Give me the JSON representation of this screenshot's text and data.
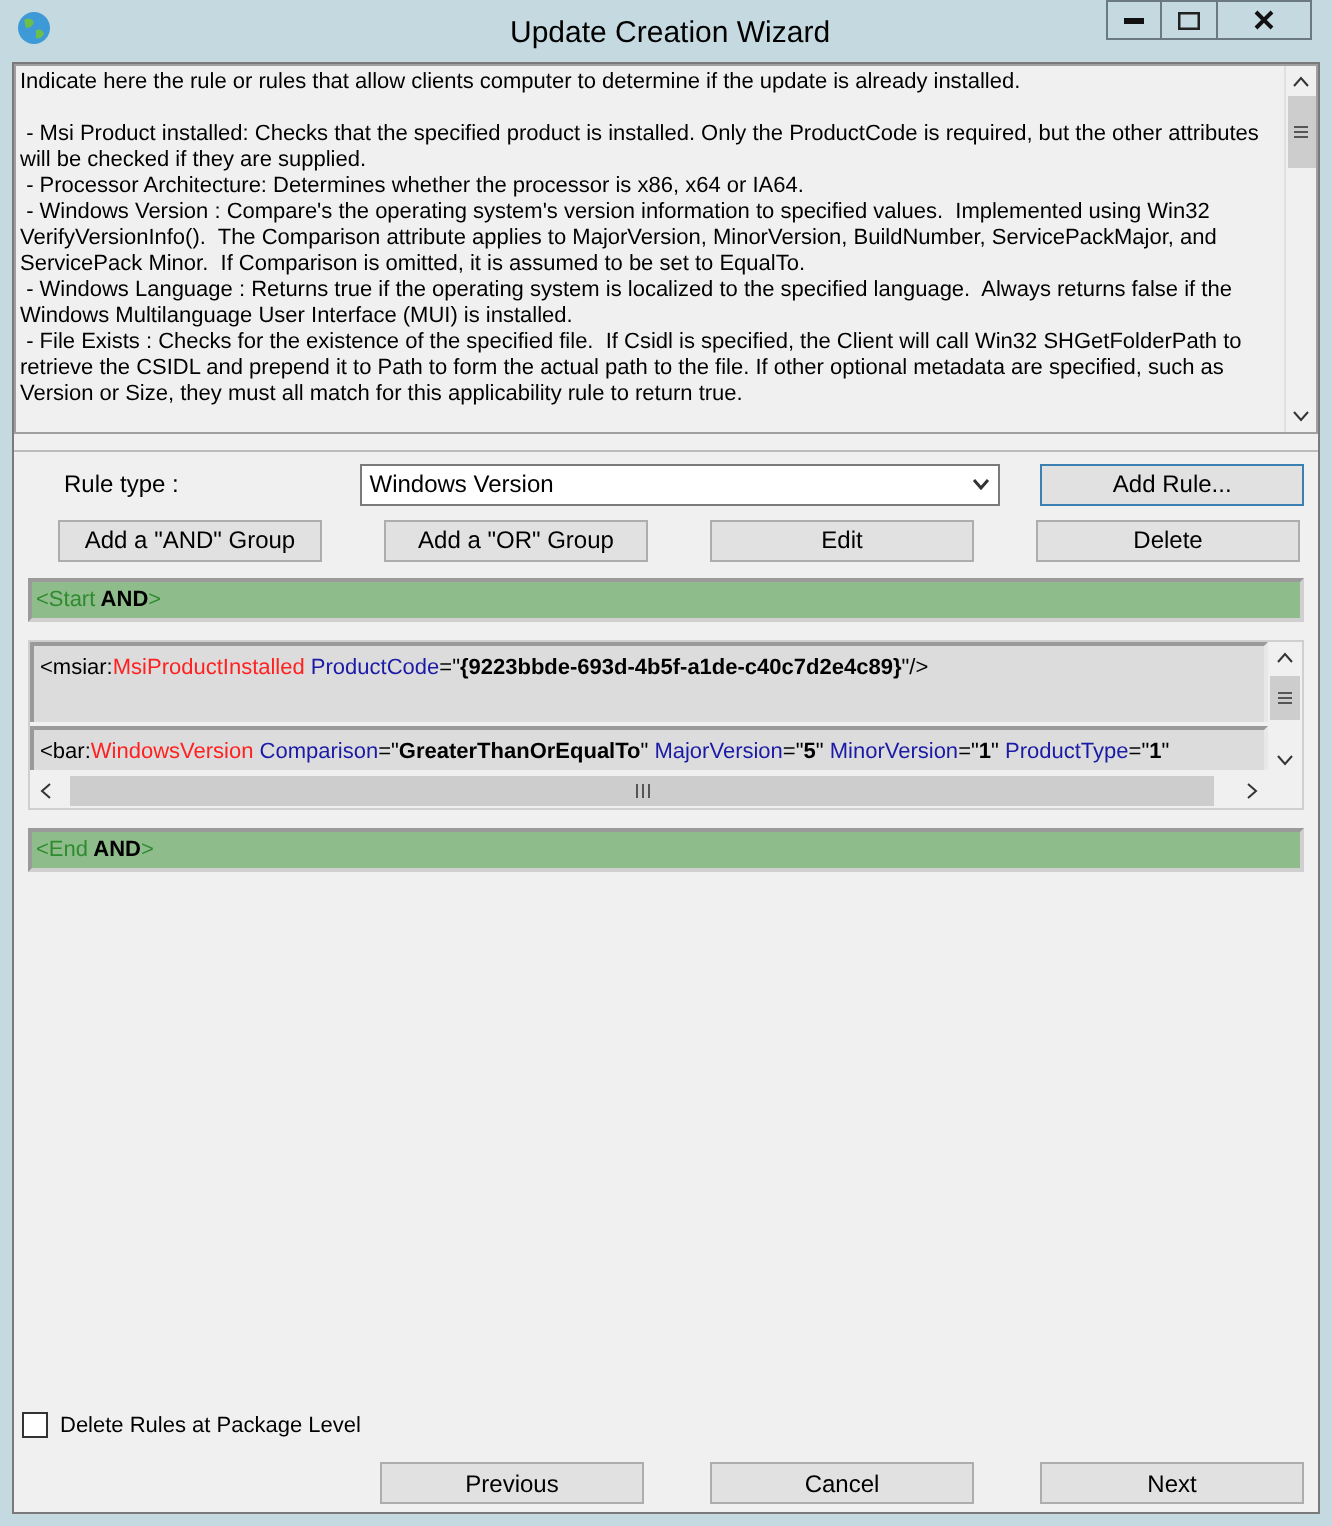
{
  "window": {
    "title": "Update Creation Wizard"
  },
  "description": {
    "intro": "Indicate here the rule or rules that allow clients computer to determine if the update is already installed.",
    "items": [
      " - Msi Product installed: Checks that the specified product is installed. Only the ProductCode is required, but the other attributes will be checked if they are supplied.",
      " - Processor Architecture: Determines whether the processor is x86, x64 or IA64.",
      " - Windows Version : Compare's the operating system's version information to specified values.  Implemented using Win32 VerifyVersionInfo().  The Comparison attribute applies to MajorVersion, MinorVersion, BuildNumber, ServicePackMajor, and ServicePack Minor.  If Comparison is omitted, it is assumed to be set to EqualTo.",
      " - Windows Language : Returns true if the operating system is localized to the specified language.  Always returns false if the Windows Multilanguage User Interface (MUI) is installed.",
      " - File Exists : Checks for the existence of the specified file.  If Csidl is specified, the Client will call Win32 SHGetFolderPath to retrieve the CSIDL and prepend it to Path to form the actual path to the file. If other optional metadata are specified, such as Version or Size, they must all match for this applicability rule to return true."
    ]
  },
  "rule_type": {
    "label": "Rule type :",
    "value": "Windows Version"
  },
  "buttons": [
    "Add Rule...",
    "Add a \"AND\" Group",
    "Add a \"OR\" Group",
    "Edit",
    "Delete"
  ],
  "rules": [
    {
      "kind": "group",
      "tokens": [
        {
          "kind": "marker",
          "text": "<Start"
        },
        {
          "kind": "keyword",
          "text": " AND"
        },
        {
          "kind": "marker",
          "text": ">"
        }
      ]
    },
    {
      "kind": "rule",
      "tokens": [
        {
          "kind": "punct",
          "text": "<msiar:"
        },
        {
          "kind": "element",
          "text": "MsiProductInstalled"
        },
        {
          "kind": "attribute",
          "text": " ProductCode"
        },
        {
          "kind": "punct",
          "text": "=\""
        },
        {
          "kind": "value",
          "text": "{9223bbde-693d-4b5f-a1de-c40c7d2e4c89}"
        },
        {
          "kind": "punct",
          "text": "\"/>"
        }
      ]
    },
    {
      "kind": "rule",
      "tokens": [
        {
          "kind": "punct",
          "text": "<bar:"
        },
        {
          "kind": "element",
          "text": "WindowsVersion"
        },
        {
          "kind": "attribute",
          "text": " Comparison"
        },
        {
          "kind": "punct",
          "text": "=\""
        },
        {
          "kind": "value",
          "text": "GreaterThanOrEqualTo"
        },
        {
          "kind": "punct",
          "text": "\""
        },
        {
          "kind": "attribute",
          "text": " MajorVersion"
        },
        {
          "kind": "punct",
          "text": "=\""
        },
        {
          "kind": "value",
          "text": "5"
        },
        {
          "kind": "punct",
          "text": "\""
        },
        {
          "kind": "attribute",
          "text": " MinorVersion"
        },
        {
          "kind": "punct",
          "text": "=\""
        },
        {
          "kind": "value",
          "text": "1"
        },
        {
          "kind": "punct",
          "text": "\""
        },
        {
          "kind": "attribute",
          "text": " ProductType"
        },
        {
          "kind": "punct",
          "text": "=\""
        },
        {
          "kind": "value",
          "text": "1"
        },
        {
          "kind": "punct",
          "text": "\""
        }
      ]
    },
    {
      "kind": "group",
      "tokens": [
        {
          "kind": "marker",
          "text": "<End"
        },
        {
          "kind": "keyword",
          "text": " AND"
        },
        {
          "kind": "marker",
          "text": ">"
        }
      ]
    }
  ],
  "delete_rules_checkbox": {
    "label": "Delete Rules at Package Level",
    "checked": false
  },
  "nav_buttons": [
    "Previous",
    "Cancel",
    "Next"
  ]
}
